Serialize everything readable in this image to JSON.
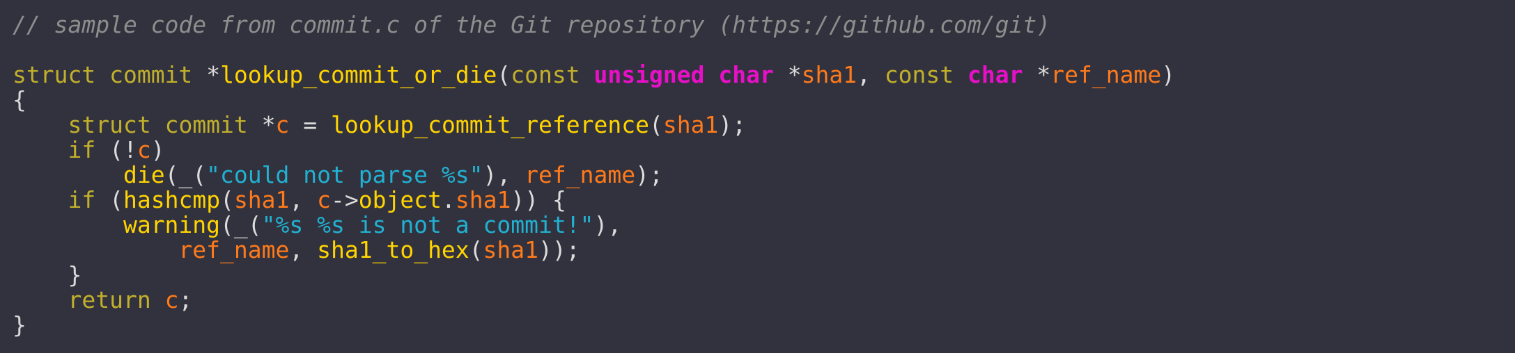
{
  "code": {
    "comment": "// sample code from commit.c of the Git repository (https://github.com/git)",
    "l3": {
      "kw_struct": "struct",
      "kw_commit": "commit",
      "ptr": "*",
      "fn_name": "lookup_commit_or_die",
      "open": "(",
      "kw_const1": "const",
      "t_unsigned": "unsigned",
      "t_char1": "char",
      "ptr2": "*",
      "p_sha1": "sha1",
      "comma": ",",
      "kw_const2": "const",
      "t_char2": "char",
      "ptr3": "*",
      "p_ref": "ref_name",
      "close": ")"
    },
    "l4": {
      "brace": "{"
    },
    "l5": {
      "kw_struct": "struct",
      "kw_commit": "commit",
      "ptr": "*",
      "var_c": "c",
      "eq": "=",
      "fn": "lookup_commit_reference",
      "open": "(",
      "arg": "sha1",
      "close": ");"
    },
    "l6": {
      "kw_if": "if",
      "open": "(!",
      "var_c": "c",
      "close": ")"
    },
    "l7": {
      "fn_die": "die",
      "open": "(_(",
      "str": "\"could not parse %s\"",
      "mid": "),",
      "arg": "ref_name",
      "close": ");"
    },
    "l8": {
      "kw_if": "if",
      "open": "(",
      "fn": "hashcmp",
      "open2": "(",
      "arg1": "sha1",
      "comma": ",",
      "var_c": "c",
      "arrow": "->",
      "member": "object",
      "dot": ".",
      "member2": "sha1",
      "close": ")) {"
    },
    "l9": {
      "fn": "warning",
      "open": "(_(",
      "str": "\"%s %s is not a commit!\"",
      "close": "),"
    },
    "l10": {
      "arg": "ref_name",
      "comma": ",",
      "fn": "sha1_to_hex",
      "open": "(",
      "arg2": "sha1",
      "close": "));"
    },
    "l11": {
      "brace": "}"
    },
    "l12": {
      "kw_return": "return",
      "var_c": "c",
      "semi": ";"
    },
    "l13": {
      "brace": "}"
    }
  }
}
